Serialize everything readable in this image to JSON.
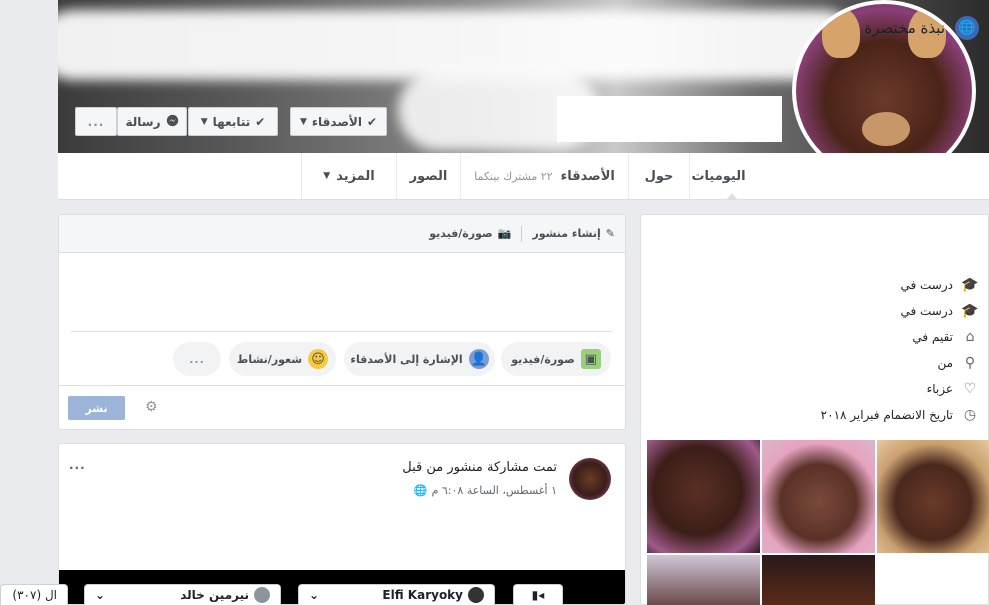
{
  "cover": {
    "buttons": {
      "friends": "الأصدقاء",
      "follow": "تتابعها",
      "message": "رسالة",
      "more": "..."
    }
  },
  "tabs": {
    "timeline": "اليوميات",
    "about": "حول",
    "friends": "الأصدقاء",
    "mutual": "٢٢ مشترك بينكما",
    "photos": "الصور",
    "more": "المزيد"
  },
  "intro": {
    "title": "نبذة مختصرة",
    "rows": [
      {
        "icon": "graduation-cap-icon",
        "text": "درست في"
      },
      {
        "icon": "graduation-cap-icon",
        "text": "درست في"
      },
      {
        "icon": "home-icon",
        "text": "تقيم في"
      },
      {
        "icon": "location-pin-icon",
        "text": "من"
      },
      {
        "icon": "heart-icon",
        "text": "عزباء"
      },
      {
        "icon": "clock-icon",
        "text": "تاريخ الانضمام فبراير ٢٠١٨"
      }
    ]
  },
  "composer": {
    "create_post": "إنشاء منشور",
    "photo_video": "صورة/فيديو",
    "pill_photo": "صورة/فيديو",
    "pill_tag": "الإشارة إلى الأصدقاء",
    "pill_feeling": "شعور/نشاط",
    "pill_more": "...",
    "post_button": "نشر"
  },
  "post": {
    "title": "تمت مشاركة منشور من قبل",
    "meta": "١ أغسطس، الساعة ٦:٠٨ م",
    "more": "..."
  },
  "chat": {
    "left_count": "(٣٠٧) ال",
    "tab1_name": "نيرمين خالد",
    "tab2_name": "Elfi Karyoky"
  }
}
